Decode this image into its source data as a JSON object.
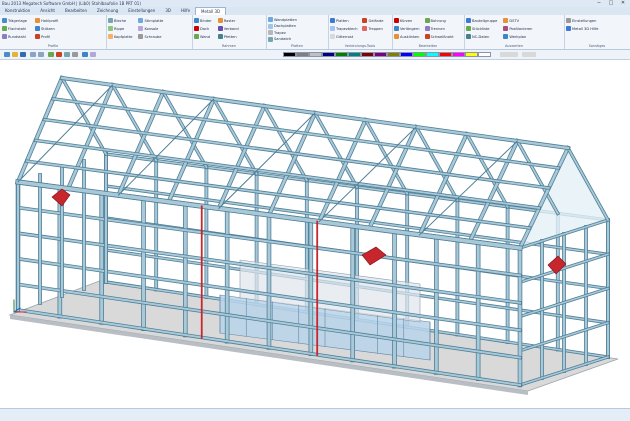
{
  "titlebar": {
    "title": "Bau 2013 Megatech Software GmbH | (Lib0) Stahlbaufolie 1B PRT 01)",
    "buttons": [
      "─",
      "□",
      "✕"
    ]
  },
  "tabs": [
    {
      "label": "Konstruktion",
      "active": false
    },
    {
      "label": "Ansicht",
      "active": false
    },
    {
      "label": "Bearbeiten",
      "active": false
    },
    {
      "label": "Zeichnung",
      "active": false
    },
    {
      "label": "Einstellungen",
      "active": false
    },
    {
      "label": "3D",
      "active": false
    },
    {
      "label": "Hilfe",
      "active": false
    },
    {
      "label": "Metall 3D",
      "active": true
    }
  ],
  "ribbon": {
    "groups": [
      {
        "label": "Profile",
        "items": [
          "Trägerlage",
          "Flachstahl",
          "Rundstahl",
          "Hohlprofil",
          "Stützen",
          "Profil"
        ]
      },
      {
        "label": "",
        "items": [
          "Bleche",
          "Rippe",
          "Kopfplatte",
          "Stirnplatte",
          "Konsole",
          "Schraube"
        ]
      },
      {
        "label": "Rahmen",
        "items": [
          "Binder",
          "Dach",
          "Wand",
          "Raster",
          "Verband",
          "Pfetten"
        ]
      },
      {
        "label": "Platten",
        "items": [
          "Wandplatten",
          "Dachplatten",
          "Trapez",
          "Sandwich"
        ]
      },
      {
        "label": "Verbindungs-Tools",
        "items": [
          "Platten",
          "Trapezblech",
          "Gitterrost",
          "Gelände",
          "Treppen"
        ]
      },
      {
        "label": "Bearbeiten",
        "items": [
          "Kürzen",
          "Verlängern",
          "Ausklinken",
          "Bohrung",
          "Trennen",
          "Schweißnaht"
        ]
      },
      {
        "label": "Auswerten",
        "items": [
          "Bauteilgruppe",
          "Stückliste",
          "NC-Daten",
          "DSTV",
          "Positionieren",
          "Werkplan"
        ]
      },
      {
        "label": "Sonstiges",
        "items": [
          "Einstellungen",
          "Metall 3D Hilfe"
        ]
      }
    ]
  },
  "toolbar": {
    "swatches": [
      "#000000",
      "#7f7f7f",
      "#c0c0c0",
      "#00007f",
      "#007f00",
      "#007f7f",
      "#7f0000",
      "#7f007f",
      "#7f7f00",
      "#0000ff",
      "#00ff00",
      "#00ffff",
      "#ff0000",
      "#ff00ff",
      "#ffff00",
      "#ffffff"
    ]
  },
  "colors": {
    "steel": "#a9c9d9",
    "steel_dark": "#4f7f96",
    "steel_light": "#e3f0f6",
    "red": "#c8262d",
    "glass": "#b9d4ea",
    "ground": "#d9d9d9",
    "accent": "#2a6ebb"
  }
}
